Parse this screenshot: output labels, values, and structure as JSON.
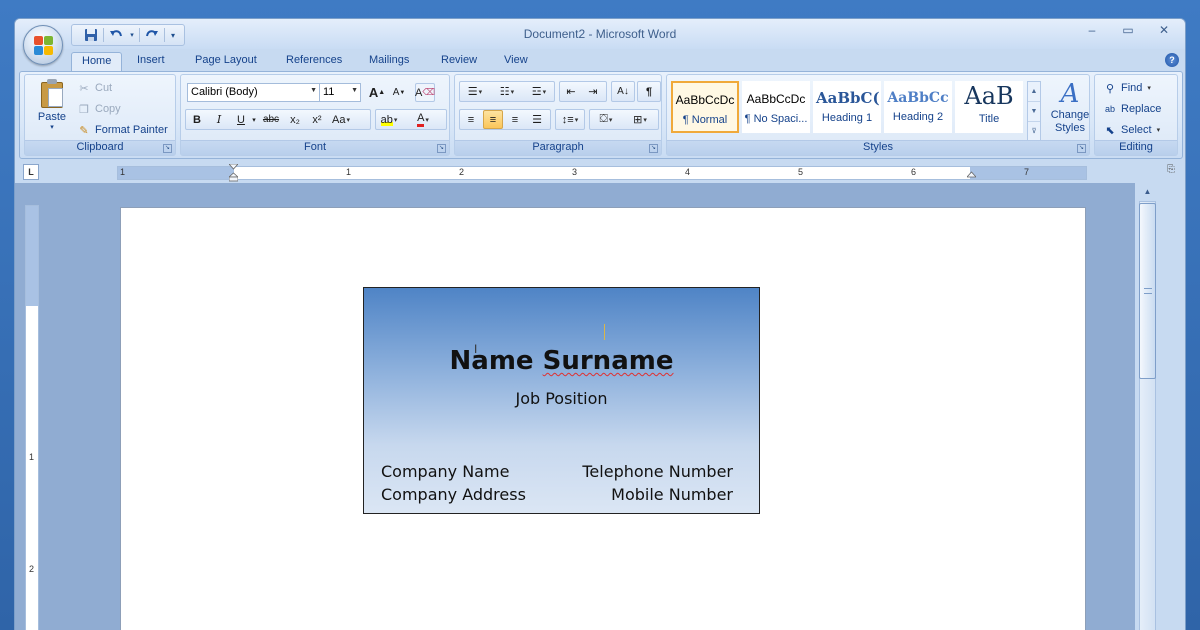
{
  "window": {
    "title": "Document2 - Microsoft Word",
    "controls": [
      "–",
      "▭",
      "✕"
    ]
  },
  "qat": {
    "save_icon": "save-icon",
    "undo_icon": "undo-icon",
    "redo_icon": "redo-icon",
    "customize_icon": "customize-qat-icon"
  },
  "tabs": [
    "Home",
    "Insert",
    "Page Layout",
    "References",
    "Mailings",
    "Review",
    "View"
  ],
  "active_tab": "Home",
  "clipboard": {
    "label": "Clipboard",
    "paste": "Paste",
    "cut": "Cut",
    "copy": "Copy",
    "format_painter": "Format Painter"
  },
  "font": {
    "label": "Font",
    "family": "Calibri (Body)",
    "size": "11",
    "bold": "B",
    "italic": "I",
    "underline": "U",
    "strikethrough": "abc",
    "subscript": "x₂",
    "superscript": "x²",
    "change_case": "Aa",
    "grow": "A",
    "shrink": "A",
    "clear": "A",
    "font_color": "A"
  },
  "paragraph": {
    "label": "Paragraph",
    "show_marks": "¶",
    "alignment": "center"
  },
  "styles": {
    "label": "Styles",
    "items": [
      {
        "sample": "AaBbCcDc",
        "name": "¶ Normal",
        "selected": true
      },
      {
        "sample": "AaBbCcDc",
        "name": "¶ No Spaci...",
        "selected": false
      },
      {
        "sample": "AaBbC(",
        "name": "Heading 1",
        "selected": false
      },
      {
        "sample": "AaBbCc",
        "name": "Heading 2",
        "selected": false
      },
      {
        "sample": "AaB",
        "name": "Title",
        "selected": false
      }
    ],
    "change_styles": "Change Styles"
  },
  "editing": {
    "label": "Editing",
    "find": "Find",
    "replace": "Replace",
    "select": "Select"
  },
  "ruler": {
    "numbers": [
      "1",
      "1",
      "2",
      "3",
      "4",
      "5",
      "6",
      "7"
    ]
  },
  "vruler": {
    "numbers": [
      "1",
      "2"
    ]
  },
  "card": {
    "name": "Name Surname",
    "name_misspelled_word": "Surname",
    "job": "Job Position",
    "company_name": "Company Name",
    "company_address": "Company Address",
    "telephone": "Telephone Number",
    "mobile": "Mobile Number"
  },
  "colors": {
    "ribbon_bg": "#d9e7f8",
    "window_frame": "#3b74b8",
    "selected_style_border": "#f0a93a",
    "card_gradient_top": "#4f84c6",
    "card_gradient_bottom": "#dbe6f4"
  }
}
